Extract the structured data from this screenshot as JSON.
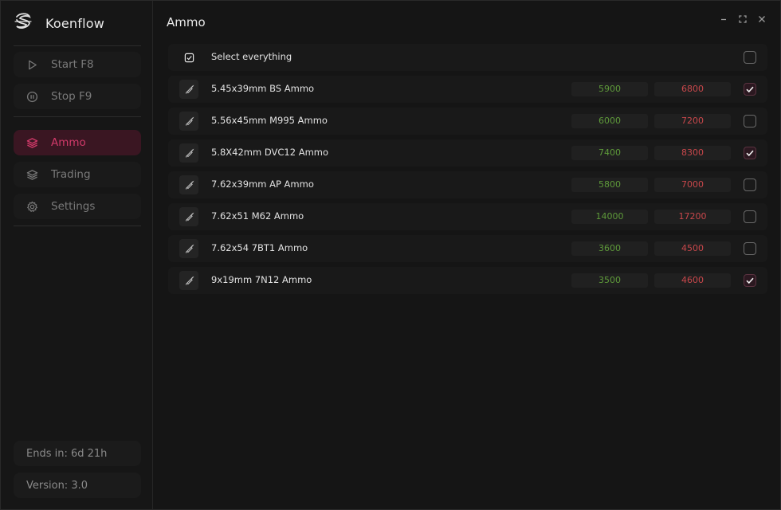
{
  "app": {
    "name": "Koenflow"
  },
  "sidebar": {
    "items": [
      {
        "label": "Start F8",
        "icon": "play-icon"
      },
      {
        "label": "Stop F9",
        "icon": "pause-circle-icon"
      },
      {
        "label": "Ammo",
        "icon": "layers-icon",
        "active": true
      },
      {
        "label": "Trading",
        "icon": "layers-icon"
      },
      {
        "label": "Settings",
        "icon": "gear-icon"
      }
    ],
    "footer": {
      "ends_in": "Ends in: 6d 21h",
      "version": "Version: 3.0"
    }
  },
  "main": {
    "title": "Ammo",
    "select_all": {
      "label": "Select everything",
      "checked": false
    },
    "rows": [
      {
        "name": "5.45x39mm BS Ammo",
        "buy": "5900",
        "sell": "6800",
        "checked": true
      },
      {
        "name": "5.56x45mm M995 Ammo",
        "buy": "6000",
        "sell": "7200",
        "checked": false
      },
      {
        "name": "5.8X42mm DVC12 Ammo",
        "buy": "7400",
        "sell": "8300",
        "checked": true
      },
      {
        "name": "7.62x39mm AP Ammo",
        "buy": "5800",
        "sell": "7000",
        "checked": false
      },
      {
        "name": "7.62x51 M62 Ammo",
        "buy": "14000",
        "sell": "17200",
        "checked": false
      },
      {
        "name": "7.62x54 7BT1 Ammo",
        "buy": "3600",
        "sell": "4500",
        "checked": false
      },
      {
        "name": "9x19mm 7N12 Ammo",
        "buy": "3500",
        "sell": "4600",
        "checked": true
      }
    ]
  },
  "colors": {
    "accent": "#d23a6a",
    "buy": "#5e9a3a",
    "sell": "#c8474b"
  }
}
